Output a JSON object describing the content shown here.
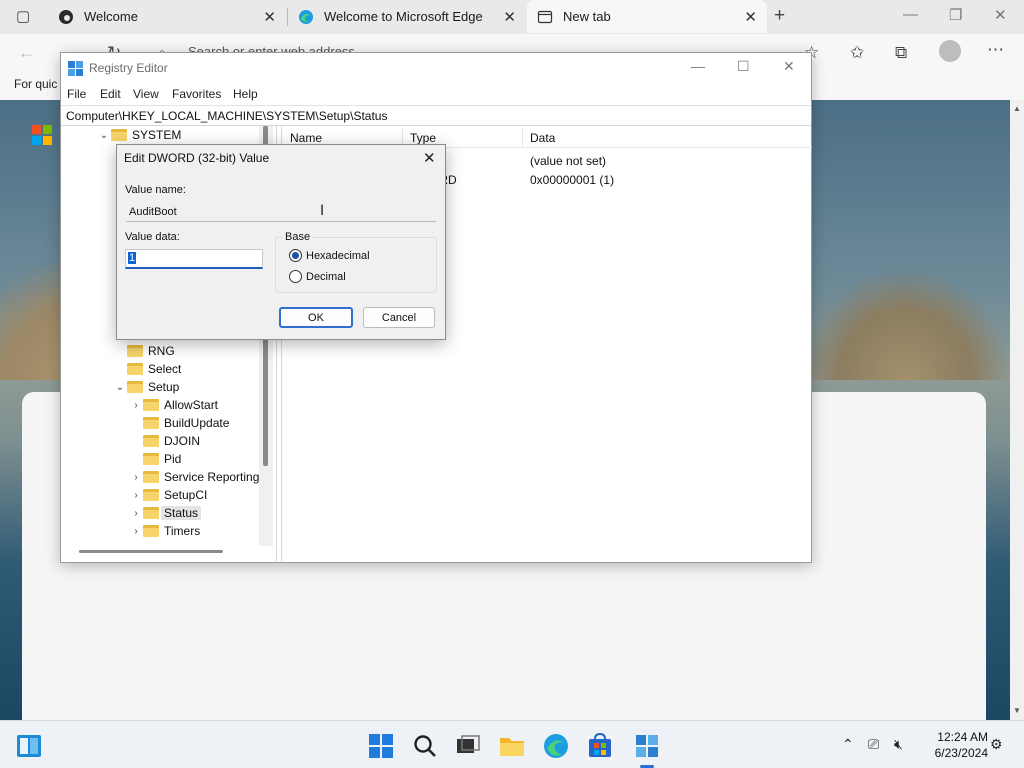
{
  "browser": {
    "tabs": [
      {
        "label": "Welcome",
        "icon": "edge-dark-icon"
      },
      {
        "label": "Welcome to Microsoft Edge",
        "icon": "edge-icon"
      },
      {
        "label": "New tab",
        "icon": "new-tab-page-icon"
      }
    ],
    "address_placeholder": "Search or enter web address",
    "favorites_bar_text": "For quic"
  },
  "regedit": {
    "title": "Registry Editor",
    "menu": [
      "File",
      "Edit",
      "View",
      "Favorites",
      "Help"
    ],
    "address": "Computer\\HKEY_LOCAL_MACHINE\\SYSTEM\\Setup\\Status",
    "tree": {
      "root": "SYSTEM",
      "items": [
        "RNG",
        "Select",
        "Setup"
      ],
      "setup_children": [
        "AllowStart",
        "BuildUpdate",
        "DJOIN",
        "Pid",
        "Service Reporting",
        "SetupCI",
        "Status",
        "Timers"
      ],
      "selected": "Status"
    },
    "columns": {
      "name": "Name",
      "type": "Type",
      "data": "Data"
    },
    "rows": [
      {
        "type": "",
        "data": "(value not set)"
      },
      {
        "type": "DWORD",
        "data": "0x00000001 (1)"
      }
    ]
  },
  "dialog": {
    "title": "Edit DWORD (32-bit) Value",
    "value_name_label": "Value name:",
    "value_name": "AuditBoot",
    "value_data_label": "Value data:",
    "value_data": "1",
    "base_label": "Base",
    "base_options": [
      "Hexadecimal",
      "Decimal"
    ],
    "base_selected": "Hexadecimal",
    "ok_label": "OK",
    "cancel_label": "Cancel"
  },
  "taskbar": {
    "time": "12:24 AM",
    "date": "6/23/2024"
  },
  "colors": {
    "accent": "#0a64d6",
    "folder": "#f6d36b",
    "taskbar": "#eef1f5"
  }
}
